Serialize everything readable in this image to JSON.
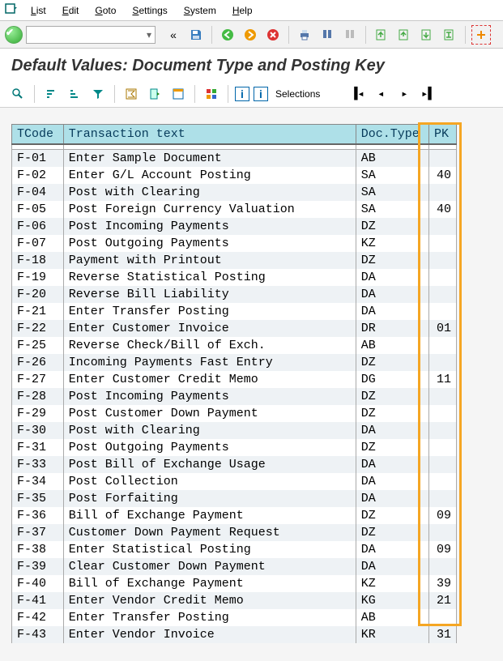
{
  "menu": {
    "items": [
      "List",
      "Edit",
      "Goto",
      "Settings",
      "System",
      "Help"
    ]
  },
  "title": "Default Values: Document Type and Posting Key",
  "toolbar2": {
    "selections_label": "Selections"
  },
  "columns": {
    "tcode": "TCode",
    "text": "Transaction text",
    "doctype": "Doc.Type",
    "pk": "PK"
  },
  "rows": [
    {
      "tcode": "F-01",
      "text": "Enter Sample Document",
      "doctype": "AB",
      "pk": ""
    },
    {
      "tcode": "F-02",
      "text": "Enter G/L Account Posting",
      "doctype": "SA",
      "pk": "40"
    },
    {
      "tcode": "F-04",
      "text": "Post with Clearing",
      "doctype": "SA",
      "pk": ""
    },
    {
      "tcode": "F-05",
      "text": "Post Foreign Currency Valuation",
      "doctype": "SA",
      "pk": "40"
    },
    {
      "tcode": "F-06",
      "text": "Post Incoming Payments",
      "doctype": "DZ",
      "pk": ""
    },
    {
      "tcode": "F-07",
      "text": "Post Outgoing Payments",
      "doctype": "KZ",
      "pk": ""
    },
    {
      "tcode": "F-18",
      "text": "Payment with Printout",
      "doctype": "DZ",
      "pk": ""
    },
    {
      "tcode": "F-19",
      "text": "Reverse Statistical Posting",
      "doctype": "DA",
      "pk": ""
    },
    {
      "tcode": "F-20",
      "text": "Reverse Bill Liability",
      "doctype": "DA",
      "pk": ""
    },
    {
      "tcode": "F-21",
      "text": "Enter Transfer Posting",
      "doctype": "DA",
      "pk": ""
    },
    {
      "tcode": "F-22",
      "text": "Enter Customer Invoice",
      "doctype": "DR",
      "pk": "01"
    },
    {
      "tcode": "F-25",
      "text": "Reverse Check/Bill of Exch.",
      "doctype": "AB",
      "pk": ""
    },
    {
      "tcode": "F-26",
      "text": "Incoming Payments Fast Entry",
      "doctype": "DZ",
      "pk": ""
    },
    {
      "tcode": "F-27",
      "text": "Enter Customer Credit Memo",
      "doctype": "DG",
      "pk": "11"
    },
    {
      "tcode": "F-28",
      "text": "Post Incoming Payments",
      "doctype": "DZ",
      "pk": ""
    },
    {
      "tcode": "F-29",
      "text": "Post Customer Down Payment",
      "doctype": "DZ",
      "pk": ""
    },
    {
      "tcode": "F-30",
      "text": "Post with Clearing",
      "doctype": "DA",
      "pk": ""
    },
    {
      "tcode": "F-31",
      "text": "Post Outgoing Payments",
      "doctype": "DZ",
      "pk": ""
    },
    {
      "tcode": "F-33",
      "text": "Post Bill of Exchange Usage",
      "doctype": "DA",
      "pk": ""
    },
    {
      "tcode": "F-34",
      "text": "Post Collection",
      "doctype": "DA",
      "pk": ""
    },
    {
      "tcode": "F-35",
      "text": "Post Forfaiting",
      "doctype": "DA",
      "pk": ""
    },
    {
      "tcode": "F-36",
      "text": "Bill of Exchange Payment",
      "doctype": "DZ",
      "pk": "09"
    },
    {
      "tcode": "F-37",
      "text": "Customer Down Payment Request",
      "doctype": "DZ",
      "pk": ""
    },
    {
      "tcode": "F-38",
      "text": "Enter Statistical Posting",
      "doctype": "DA",
      "pk": "09"
    },
    {
      "tcode": "F-39",
      "text": "Clear Customer Down Payment",
      "doctype": "DA",
      "pk": ""
    },
    {
      "tcode": "F-40",
      "text": "Bill of Exchange Payment",
      "doctype": "KZ",
      "pk": "39"
    },
    {
      "tcode": "F-41",
      "text": "Enter Vendor Credit Memo",
      "doctype": "KG",
      "pk": "21"
    },
    {
      "tcode": "F-42",
      "text": "Enter Transfer Posting",
      "doctype": "AB",
      "pk": ""
    },
    {
      "tcode": "F-43",
      "text": "Enter Vendor Invoice",
      "doctype": "KR",
      "pk": "31"
    }
  ]
}
